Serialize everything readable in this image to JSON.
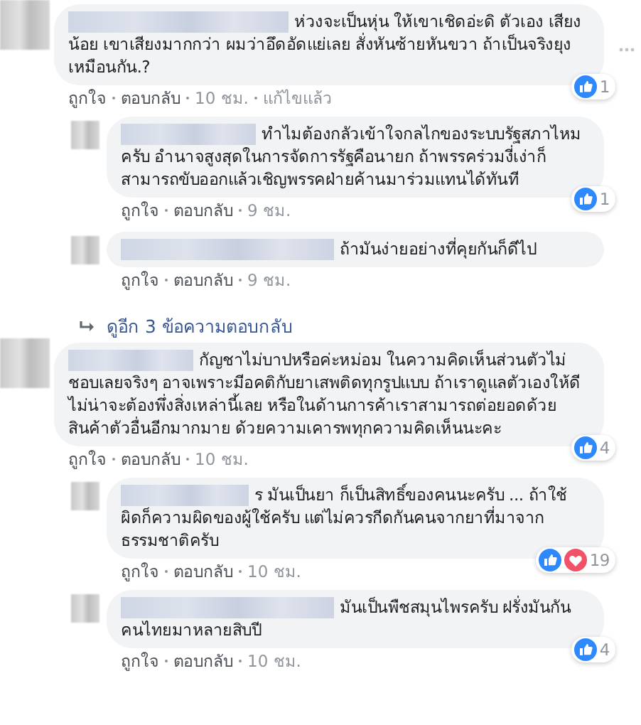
{
  "comments": [
    {
      "kind": "comment",
      "text": "ห่วงจะเป็นหุ่น ให้เขาเชิดอ่ะดิ ตัวเอง เสียงน้อย เขาเสียงมากกว่า ผมว่าอึดอัดแย่เลย สั่งหันซ้ายหันขวา ถ้าเป็นจริงยุงเหมือนกัน.?",
      "actions": [
        "ถูกใจ",
        "ตอบกลับ"
      ],
      "time": "10 ชม.",
      "edited": "แก้ไขแล้ว",
      "reactions": {
        "kind": "like",
        "count": "1"
      },
      "more_menu": true
    },
    {
      "kind": "reply",
      "text": "ทำไมต้องกลัวเข้าใจกลไกของระบบรัฐสภาไหมครับ อำนาจสูงสุดในการจัดการรัฐคือนายก ถ้าพรรคร่วมงี่เง่าก็สามารถขับออกแล้วเชิญพรรคฝ่ายค้านมาร่วมแทนได้ทันที",
      "actions": [
        "ถูกใจ",
        "ตอบกลับ"
      ],
      "time": "9 ชม.",
      "reactions": {
        "kind": "like",
        "count": "1"
      }
    },
    {
      "kind": "reply",
      "text": "ถ้ามันง่ายอย่างที่คุยกันก็ดีไป",
      "actions": [
        "ถูกใจ",
        "ตอบกลับ"
      ],
      "time": "9 ชม."
    },
    {
      "kind": "more_replies",
      "text": "ดูอีก 3 ข้อความตอบกลับ"
    },
    {
      "kind": "comment",
      "text": "กัญชาไม่บาปหรือค่ะหม่อม ในความคิดเห็นส่วนตัวไม่ชอบเลยจริงๆ อาจเพราะมีอคติกับยาเสพติดทุกรูปแบบ ถ้าเราดูแลตัวเองให้ดีไม่น่าจะต้องพึ่งสิ่งเหล่านี้เลย หรือในด้านการค้าเราสามารถต่อยอดด้วยสินค้าตัวอื่นอีกมากมาย ด้วยความเคารพทุกความคิดเห็นนะคะ",
      "actions": [
        "ถูกใจ",
        "ตอบกลับ"
      ],
      "time": "10 ชม.",
      "reactions": {
        "kind": "like",
        "count": "4"
      }
    },
    {
      "kind": "reply",
      "text": "ร มันเป็นยา ก็เป็นสิทธิ์ของคนนะครับ ... ถ้าใช้ผิดก็ความผิดของผู้ใช้ครับ แต่ไม่ควรกีดกันคนจากยาที่มาจากธรรมชาติครับ",
      "actions": [
        "ถูกใจ",
        "ตอบกลับ"
      ],
      "time": "10 ชม.",
      "reactions": {
        "kind": "like_love",
        "count": "19"
      }
    },
    {
      "kind": "reply",
      "text": "มันเป็นพืชสมุนไพรครับ ฝรั่งมันกันคนไทยมาหลายสิบปี",
      "actions": [
        "ถูกใจ",
        "ตอบกลับ"
      ],
      "time": "10 ชม.",
      "reactions": {
        "kind": "like",
        "count": "4"
      }
    }
  ]
}
